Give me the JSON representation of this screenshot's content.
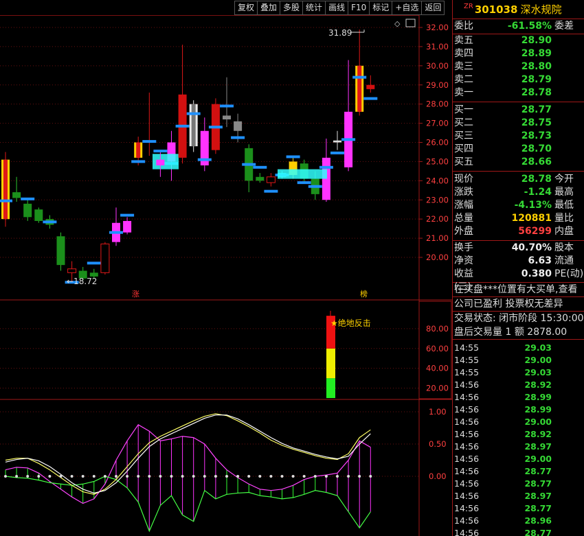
{
  "toolbar": [
    "复权",
    "叠加",
    "多股",
    "统计",
    "画线",
    "F10",
    "标记",
    "+自选",
    "返回"
  ],
  "stock": {
    "prefix": "ZR",
    "code": "301038",
    "name": "深水规院"
  },
  "weibi": {
    "label": "委比",
    "value": "-61.58%",
    "right": "委差"
  },
  "asks": [
    {
      "label": "卖五",
      "price": "28.90"
    },
    {
      "label": "卖四",
      "price": "28.89"
    },
    {
      "label": "卖三",
      "price": "28.80"
    },
    {
      "label": "卖二",
      "price": "28.79"
    },
    {
      "label": "卖一",
      "price": "28.78"
    }
  ],
  "bids": [
    {
      "label": "买一",
      "price": "28.77"
    },
    {
      "label": "买二",
      "price": "28.75"
    },
    {
      "label": "买三",
      "price": "28.73"
    },
    {
      "label": "买四",
      "price": "28.70"
    },
    {
      "label": "买五",
      "price": "28.66"
    }
  ],
  "quote": [
    {
      "label": "现价",
      "value": "28.78",
      "right": "今开",
      "color": "#35d935"
    },
    {
      "label": "涨跌",
      "value": "-1.24",
      "right": "最高",
      "color": "#35d935"
    },
    {
      "label": "涨幅",
      "value": "-4.13%",
      "right": "最低",
      "color": "#35d935"
    },
    {
      "label": "总量",
      "value": "120881",
      "right": "量比",
      "color": "#ffd000"
    },
    {
      "label": "外盘",
      "value": "56299",
      "right": "内盘",
      "color": "#ff4040"
    }
  ],
  "stats": [
    {
      "label": "换手",
      "value": "40.70%",
      "right": "股本"
    },
    {
      "label": "净资",
      "value": "6.63",
      "right": "流通"
    },
    {
      "label": "收益(三)",
      "value": "0.380",
      "right": "PE(动)"
    }
  ],
  "notices": [
    "在买盘***位置有大买单,查看",
    "公司已盈利 投票权无差异"
  ],
  "trade_status": {
    "label": "交易状态:",
    "value": "闭市阶段",
    "time": "15:30:00"
  },
  "after_hours": {
    "label": "盘后交易量",
    "v1": "1",
    "label2": "额",
    "v2": "2878.00"
  },
  "ticks": [
    {
      "time": "14:55",
      "price": "29.03"
    },
    {
      "time": "14:55",
      "price": "29.00"
    },
    {
      "time": "14:55",
      "price": "29.03"
    },
    {
      "time": "14:56",
      "price": "28.92"
    },
    {
      "time": "14:56",
      "price": "28.99"
    },
    {
      "time": "14:56",
      "price": "28.99"
    },
    {
      "time": "14:56",
      "price": "29.00"
    },
    {
      "time": "14:56",
      "price": "28.92"
    },
    {
      "time": "14:56",
      "price": "28.97"
    },
    {
      "time": "14:56",
      "price": "29.00"
    },
    {
      "time": "14:56",
      "price": "28.77"
    },
    {
      "time": "14:56",
      "price": "28.77"
    },
    {
      "time": "14:56",
      "price": "28.97"
    },
    {
      "time": "14:56",
      "price": "28.77"
    },
    {
      "time": "14:56",
      "price": "28.96"
    },
    {
      "time": "14:56",
      "price": "28.77"
    }
  ],
  "chart_data": [
    {
      "type": "candlestick",
      "y_ticks": [
        "32.00",
        "31.00",
        "30.00",
        "29.00",
        "28.00",
        "27.00",
        "26.00",
        "25.00",
        "24.00",
        "23.00",
        "22.00",
        "21.00",
        "20.00"
      ],
      "ylim": [
        19.0,
        32.3
      ],
      "high_label": "31.89",
      "low_label": "←18.72",
      "markers": [
        "涨",
        "榜"
      ],
      "candles": [
        {
          "o": 25.1,
          "c": 22.0,
          "h": 25.5,
          "l": 21.6,
          "col": "yr"
        },
        {
          "o": 23.1,
          "c": 23.4,
          "h": 24.2,
          "l": 22.9,
          "col": "g"
        },
        {
          "o": 22.8,
          "c": 22.1,
          "h": 23.0,
          "l": 21.9,
          "col": "g"
        },
        {
          "o": 22.5,
          "c": 21.9,
          "h": 22.6,
          "l": 21.8,
          "col": "g"
        },
        {
          "o": 22.0,
          "c": 21.7,
          "h": 22.2,
          "l": 21.5,
          "col": "g"
        },
        {
          "o": 21.1,
          "c": 19.6,
          "h": 21.3,
          "l": 19.3,
          "col": "g"
        },
        {
          "o": 19.4,
          "c": 19.2,
          "h": 19.8,
          "l": 18.72,
          "col": "rh"
        },
        {
          "o": 19.3,
          "c": 18.9,
          "h": 19.5,
          "l": 18.8,
          "col": "g"
        },
        {
          "o": 19.2,
          "c": 19.0,
          "h": 19.4,
          "l": 18.9,
          "col": "g"
        },
        {
          "o": 19.2,
          "c": 20.7,
          "h": 20.8,
          "l": 19.1,
          "col": "rh"
        },
        {
          "o": 20.8,
          "c": 21.8,
          "h": 22.6,
          "l": 20.6,
          "col": "m"
        },
        {
          "o": 21.3,
          "c": 21.9,
          "h": 22.1,
          "l": 21.2,
          "col": "m"
        },
        {
          "o": 25.2,
          "c": 26.0,
          "h": 26.3,
          "l": 24.8,
          "col": "yr"
        },
        {
          "o": 26.0,
          "c": 26.1,
          "h": 28.6,
          "l": 25.3,
          "col": "r"
        },
        {
          "o": 24.8,
          "c": 25.1,
          "h": 25.6,
          "l": 24.2,
          "col": "m"
        },
        {
          "o": 25.0,
          "c": 26.0,
          "h": 26.6,
          "l": 24.0,
          "col": "m"
        },
        {
          "o": 25.2,
          "c": 28.5,
          "h": 31.1,
          "l": 24.9,
          "col": "r"
        },
        {
          "o": 25.8,
          "c": 28.0,
          "h": 28.2,
          "l": 25.5,
          "col": "wg"
        },
        {
          "o": 24.8,
          "c": 26.6,
          "h": 27.3,
          "l": 24.5,
          "col": "m"
        },
        {
          "o": 25.6,
          "c": 28.0,
          "h": 28.3,
          "l": 25.4,
          "col": "r"
        },
        {
          "o": 27.2,
          "c": 27.4,
          "h": 29.4,
          "l": 26.8,
          "col": "gr"
        },
        {
          "o": 26.6,
          "c": 27.1,
          "h": 27.5,
          "l": 26.0,
          "col": "gr"
        },
        {
          "o": 25.7,
          "c": 24.0,
          "h": 25.9,
          "l": 23.4,
          "col": "g"
        },
        {
          "o": 24.0,
          "c": 24.2,
          "h": 24.4,
          "l": 23.9,
          "col": "g"
        },
        {
          "o": 23.9,
          "c": 24.2,
          "h": 24.4,
          "l": 23.7,
          "col": "rh"
        },
        {
          "o": 24.2,
          "c": 24.4,
          "h": 24.5,
          "l": 24.1,
          "col": "c"
        },
        {
          "o": 24.3,
          "c": 25.0,
          "h": 25.3,
          "l": 24.1,
          "col": "y"
        },
        {
          "o": 24.9,
          "c": 24.1,
          "h": 25.1,
          "l": 23.9,
          "col": "g"
        },
        {
          "o": 24.1,
          "c": 23.3,
          "h": 24.5,
          "l": 23.0,
          "col": "g"
        },
        {
          "o": 23.0,
          "c": 25.2,
          "h": 26.2,
          "l": 22.9,
          "col": "m"
        },
        {
          "o": 26.0,
          "c": 26.1,
          "h": 26.6,
          "l": 25.6,
          "col": "w"
        },
        {
          "o": 24.7,
          "c": 27.6,
          "h": 30.3,
          "l": 24.5,
          "col": "m"
        },
        {
          "o": 27.6,
          "c": 30.0,
          "h": 31.89,
          "l": 27.4,
          "col": "yr"
        },
        {
          "o": 29.0,
          "c": 28.78,
          "h": 29.5,
          "l": 28.6,
          "col": "rf"
        }
      ]
    },
    {
      "type": "bar",
      "title": "★绝地反击",
      "y_ticks": [
        "80.00",
        "60.00",
        "40.00",
        "20.00"
      ],
      "ylim": [
        10,
        100
      ],
      "segments": [
        {
          "color": "#22ee22",
          "from": 10,
          "to": 30
        },
        {
          "color": "#eeee00",
          "from": 30,
          "to": 60
        },
        {
          "color": "#ee1111",
          "from": 60,
          "to": 93
        }
      ]
    },
    {
      "type": "line",
      "y_ticks": [
        "1.00",
        "0.50",
        "0.00"
      ],
      "ylim": [
        -0.95,
        1.1
      ],
      "series": [
        {
          "name": "",
          "values": [
            0.25,
            0.28,
            0.28,
            0.2,
            0.1,
            -0.02,
            -0.14,
            -0.24,
            -0.28,
            -0.2,
            -0.05,
            0.15,
            0.35,
            0.52,
            0.62,
            0.7,
            0.78,
            0.86,
            0.93,
            0.97,
            0.94,
            0.86,
            0.77,
            0.67,
            0.56,
            0.48,
            0.42,
            0.37,
            0.32,
            0.28,
            0.26,
            0.35,
            0.6,
            0.72
          ]
        },
        {
          "name": "",
          "values": [
            0.22,
            0.26,
            0.28,
            0.24,
            0.15,
            0.03,
            -0.1,
            -0.2,
            -0.26,
            -0.22,
            -0.1,
            0.08,
            0.28,
            0.46,
            0.58,
            0.66,
            0.74,
            0.82,
            0.9,
            0.95,
            0.95,
            0.89,
            0.8,
            0.7,
            0.6,
            0.51,
            0.44,
            0.39,
            0.34,
            0.3,
            0.27,
            0.31,
            0.5,
            0.66
          ]
        },
        {
          "name": "",
          "values": [
            0.1,
            0.14,
            0.13,
            0.05,
            -0.08,
            -0.2,
            -0.32,
            -0.42,
            -0.35,
            -0.12,
            0.25,
            0.55,
            0.8,
            0.7,
            0.55,
            0.58,
            0.62,
            0.6,
            0.5,
            0.28,
            0.1,
            -0.02,
            -0.12,
            -0.2,
            -0.22,
            -0.2,
            -0.14,
            -0.05,
            0.0,
            0.02,
            0.05,
            0.25,
            0.55,
            0.45
          ]
        },
        {
          "name": "",
          "values": [
            0.0,
            -0.02,
            -0.03,
            -0.06,
            -0.1,
            -0.12,
            -0.14,
            -0.12,
            -0.08,
            0.0,
            -0.05,
            -0.18,
            -0.4,
            -0.85,
            -0.45,
            -0.3,
            -0.6,
            -0.7,
            -0.22,
            -0.35,
            -0.28,
            -0.26,
            -0.25,
            -0.3,
            -0.32,
            -0.35,
            -0.33,
            -0.28,
            -0.22,
            -0.25,
            -0.3,
            -0.55,
            -0.8,
            -0.55
          ]
        }
      ]
    }
  ]
}
